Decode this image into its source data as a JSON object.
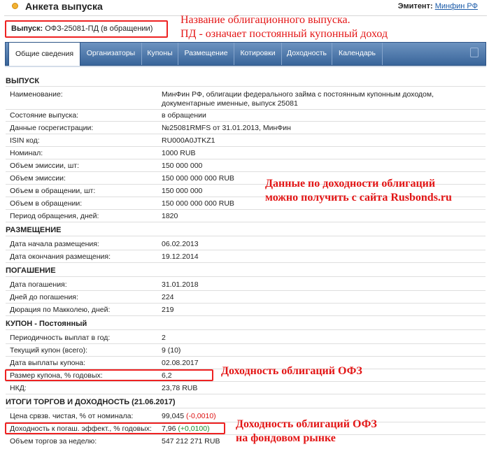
{
  "header": {
    "title": "Анкета выпуска",
    "issuer_label": "Эмитент:",
    "issuer_link": "Минфин РФ"
  },
  "issue": {
    "label": "Выпуск:",
    "value": "ОФЗ-25081-ПД (в обращении)"
  },
  "tabs": [
    {
      "label": "Общие сведения",
      "active": true
    },
    {
      "label": "Организаторы"
    },
    {
      "label": "Купоны"
    },
    {
      "label": "Размещение"
    },
    {
      "label": "Котировки"
    },
    {
      "label": "Доходность"
    },
    {
      "label": "Календарь"
    }
  ],
  "annotations": {
    "issue_name_line1": "Название облигационного выпуска.",
    "issue_name_line2": "ПД - означает постоянный купонный доход",
    "rusbonds_line1": "Данные по доходности облигаций",
    "rusbonds_line2": "можно получить с сайта Rusbonds.ru",
    "ofz_yield": "Доходность облигаций ОФЗ",
    "market_line1": "Доходность облигаций ОФЗ",
    "market_line2": "на фондовом рынке"
  },
  "sections": {
    "issue": {
      "title": "ВЫПУСК",
      "name_label": "Наименование:",
      "name_line1": "МинФин РФ, облигации федерального займа с постоянным купонным доходом,",
      "name_line2": "документарные именные, выпуск 25081",
      "state_label": "Состояние выпуска:",
      "state": "в обращении",
      "reg_label": "Данные госрегистрации:",
      "reg": "№25081RMFS от 31.01.2013, МинФин",
      "isin_label": "ISIN код:",
      "isin": "RU000A0JTKZ1",
      "nominal_label": "Номинал:",
      "nominal": "1000 RUB",
      "vol_pcs_label": "Объем эмиссии, шт:",
      "vol_pcs": "150 000 000",
      "vol_label": "Объем эмиссии:",
      "vol": "150 000 000 000 RUB",
      "circ_pcs_label": "Объем в обращении, шт:",
      "circ_pcs": "150 000 000",
      "circ_label": "Объем в обращении:",
      "circ": "150 000 000 000 RUB",
      "period_label": "Период обращения, дней:",
      "period": "1820"
    },
    "placement": {
      "title": "РАЗМЕЩЕНИЕ",
      "start_label": "Дата начала размещения:",
      "start": "06.02.2013",
      "end_label": "Дата окончания размещения:",
      "end": "19.12.2014"
    },
    "maturity": {
      "title": "ПОГАШЕНИЕ",
      "date_label": "Дата погашения:",
      "date": "31.01.2018",
      "days_label": "Дней до погашения:",
      "days": "224",
      "duration_label": "Дюрация по Макколею, дней:",
      "duration": "219"
    },
    "coupon": {
      "title": "КУПОН - Постоянный",
      "freq_label": "Периодичность выплат в год:",
      "freq": "2",
      "current_label": "Текущий купон (всего):",
      "current": "9 (10)",
      "pay_label": "Дата выплаты купона:",
      "pay": "02.08.2017",
      "rate_label": "Размер купона, % годовых:",
      "rate": "6,2",
      "nkd_label": "НКД:",
      "nkd": "23,78 RUB"
    },
    "trading": {
      "title": "ИТОГИ ТОРГОВ И ДОХОДНОСТЬ (21.06.2017)",
      "price_label": "Цена срвзв. чистая, % от номинала:",
      "price": "99,045",
      "price_change": "(-0,0010)",
      "yield_label": "Доходность к погаш. эффект., % годовых:",
      "yield": "7,96",
      "yield_change": "(+0,0100)",
      "volume_label": "Объем торгов за неделю:",
      "volume": "547 212 271 RUB"
    }
  },
  "colors": {
    "accent_red": "#e31515",
    "nav_blue": "#4a74a8",
    "link_blue": "#1a5aa8"
  }
}
